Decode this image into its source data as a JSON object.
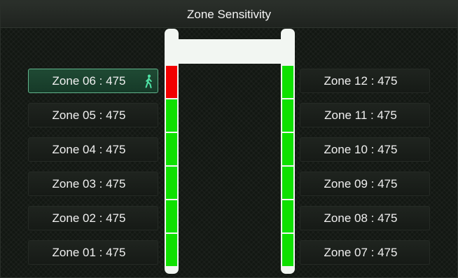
{
  "title": "Zone Sensitivity",
  "left_zones": [
    {
      "label": "Zone 06 : 475",
      "active": true,
      "icon": "walking-person-icon"
    },
    {
      "label": "Zone 05 : 475",
      "active": false
    },
    {
      "label": "Zone 04 : 475",
      "active": false
    },
    {
      "label": "Zone 03 : 475",
      "active": false
    },
    {
      "label": "Zone 02 : 475",
      "active": false
    },
    {
      "label": "Zone 01 : 475",
      "active": false
    }
  ],
  "right_zones": [
    {
      "label": "Zone 12 : 475",
      "active": false
    },
    {
      "label": "Zone 11 : 475",
      "active": false
    },
    {
      "label": "Zone 10 : 475",
      "active": false
    },
    {
      "label": "Zone 09 : 475",
      "active": false
    },
    {
      "label": "Zone 08 : 475",
      "active": false
    },
    {
      "label": "Zone 07 : 475",
      "active": false
    }
  ],
  "gate": {
    "left_segments": [
      "alarm",
      "ok",
      "ok",
      "ok",
      "ok",
      "ok"
    ],
    "right_segments": [
      "ok",
      "ok",
      "ok",
      "ok",
      "ok",
      "ok"
    ]
  },
  "colors": {
    "ok": "#0fe000",
    "alarm": "#f20000",
    "active_accent": "#62b48c",
    "walker_icon": "#4fe3a6"
  }
}
